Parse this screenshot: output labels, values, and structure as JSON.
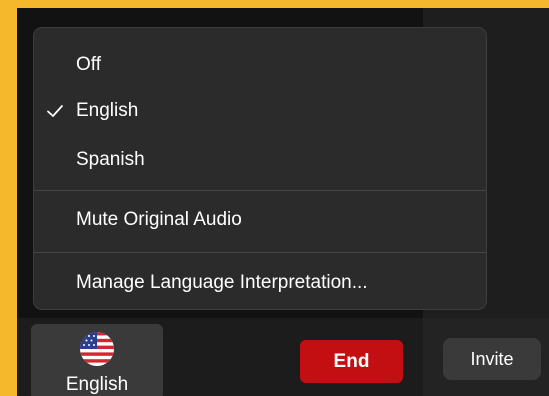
{
  "menu": {
    "items": [
      {
        "label": "Off",
        "checked": false
      },
      {
        "label": "English",
        "checked": true
      },
      {
        "label": "Spanish",
        "checked": false
      }
    ],
    "mute_original_audio": "Mute Original Audio",
    "manage_interpretation": "Manage Language Interpretation..."
  },
  "toolbar": {
    "language_button_label": "English",
    "language_flag_icon": "us-flag-icon",
    "end_label": "End",
    "invite_label": "Invite"
  },
  "colors": {
    "border": "#f5b82c",
    "end_button": "#c40f12",
    "menu_background": "#2b2b2b"
  }
}
